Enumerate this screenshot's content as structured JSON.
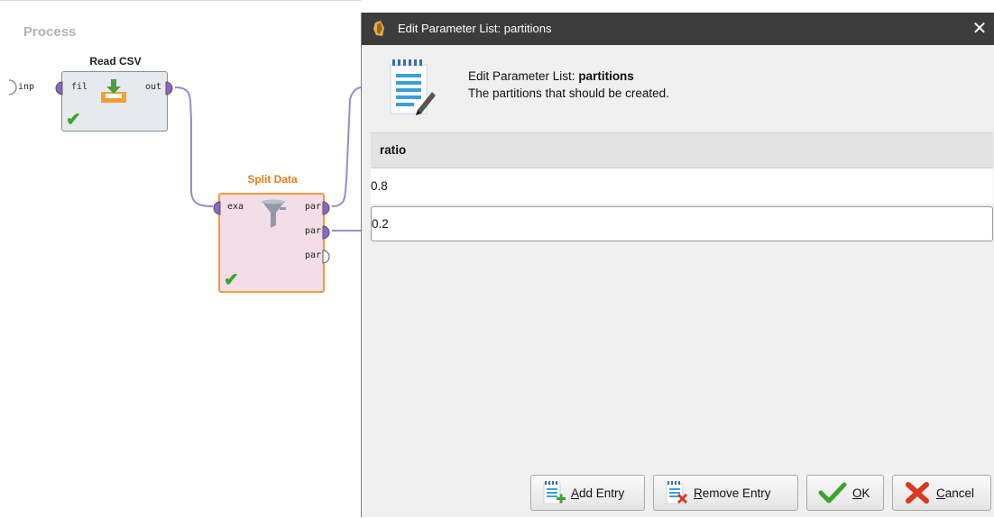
{
  "process": {
    "title": "Process",
    "read_csv": {
      "name": "Read CSV",
      "ports": {
        "input": "fil",
        "output": "out"
      }
    },
    "split_data": {
      "name": "Split Data",
      "ports": {
        "input": "exa",
        "outputs": [
          "par",
          "par",
          "par"
        ]
      }
    },
    "process_input_port": "inp"
  },
  "dialog": {
    "title": "Edit Parameter List: partitions",
    "header": {
      "line1_prefix": "Edit Parameter List: ",
      "line1_param": "partitions",
      "line2": "The partitions that should be created."
    },
    "table": {
      "column": "ratio",
      "rows": [
        "0.8",
        "0.2"
      ]
    },
    "buttons": {
      "add": {
        "mnemonic": "A",
        "rest": "dd Entry"
      },
      "remove": {
        "mnemonic": "R",
        "rest": "emove Entry"
      },
      "ok": {
        "mnemonic": "O",
        "rest": "K"
      },
      "cancel": {
        "mnemonic": "C",
        "rest": "ancel"
      }
    }
  },
  "colors": {
    "dialog_titlebar": "#3c3c3c",
    "split_data_border": "#f39a3c",
    "split_data_title": "#f07b15",
    "wire": "#9b8cc9",
    "check": "#3aa52e",
    "cancel_x": "#d9391f"
  },
  "icons": [
    "rapidminer-app-icon",
    "close-icon",
    "parameter-list-icon",
    "read-csv-icon",
    "filter-funnel-icon",
    "checkmark-icon",
    "add-entry-icon",
    "remove-entry-icon",
    "ok-checkmark-icon",
    "cancel-x-icon"
  ]
}
